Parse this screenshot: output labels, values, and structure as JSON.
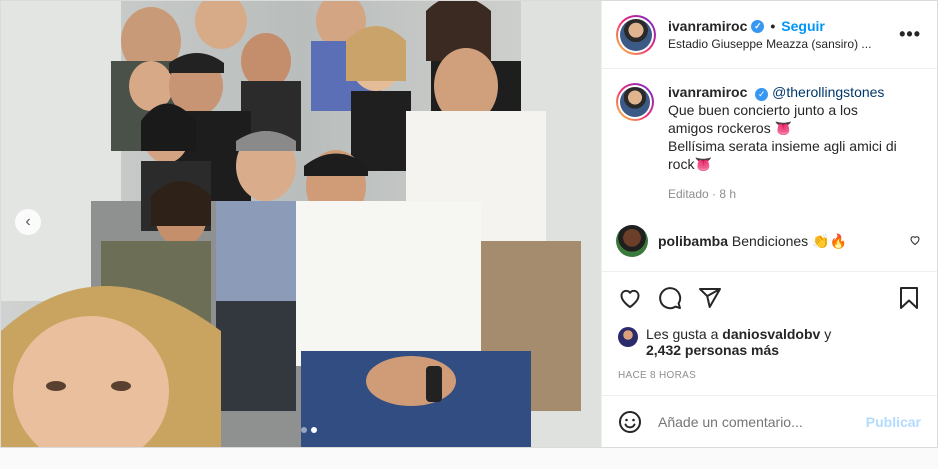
{
  "post": {
    "username": "ivanramiroc",
    "follow_label": "Seguir",
    "separator": "•",
    "location": "Estadio Giuseppe Meazza (sansiro) ...",
    "more_icon": "more-horizontal-icon"
  },
  "caption": {
    "username": "ivanramiroc",
    "mention": "@therollingstones",
    "line1": "Que buen concierto junto a los",
    "line2": "amigos rockeros 👅",
    "line3": "Bellísima serata insieme agli amici di",
    "line4": "rock👅",
    "edited": "Editado",
    "dot": "·",
    "age": "8 h"
  },
  "comments": [
    {
      "username": "polibamba",
      "text": "Bendiciones 👏🔥"
    }
  ],
  "actions": {
    "like_icon": "heart-icon",
    "comment_icon": "comment-icon",
    "share_icon": "share-icon",
    "save_icon": "bookmark-icon"
  },
  "likes": {
    "prefix": "Les gusta a",
    "first_user": "daniosvaldobv",
    "connector": "y",
    "others": "2,432 personas más"
  },
  "timestamp": "HACE 8 HORAS",
  "add_comment": {
    "placeholder": "Añade un comentario...",
    "publish_label": "Publicar",
    "emoji_icon": "emoji-icon"
  },
  "carousel": {
    "prev_icon": "chevron-left-icon",
    "slides": 2,
    "active_slide": 2
  },
  "colors": {
    "accent": "#0095f6",
    "verified": "#3897f0",
    "publish_disabled": "#b3dbff"
  }
}
